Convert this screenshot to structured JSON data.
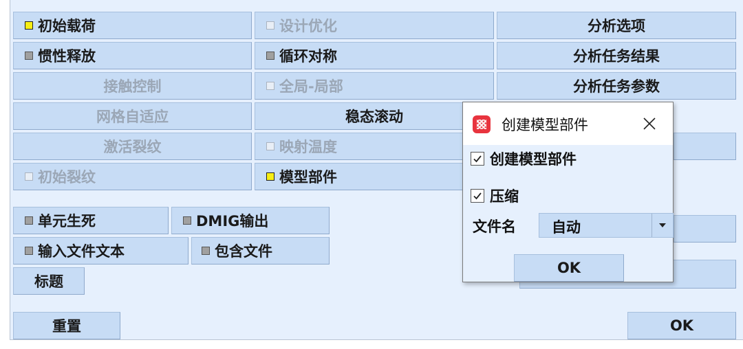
{
  "main_buttons": {
    "initial_load": "初始载荷",
    "design_opt": "设计优化",
    "analysis_options": "分析选项",
    "inertia_relief": "惯性释放",
    "cyclic_symmetry": "循环对称",
    "analysis_task_results": "分析任务结果",
    "contact_control": "接触控制",
    "global_local": "全局-局部",
    "analysis_task_params": "分析任务参数",
    "mesh_adaptive": "网格自适应",
    "steady_rolling": "稳态滚动",
    "activate_crack": "激活裂纹",
    "map_temperature": "映射温度",
    "initial_crack": "初始裂纹",
    "model_part": "模型部件",
    "element_birth_death": "单元生死",
    "dmig_output": "DMIG输出",
    "input_file_text": "输入文件文本",
    "include_file": "包含文件",
    "title": "标题",
    "reset": "重置",
    "ok": "OK"
  },
  "dialog": {
    "title": "创建模型部件",
    "create_model_part_label": "创建模型部件",
    "create_model_part_checked": true,
    "compress_label": "压缩",
    "compress_checked": true,
    "filename_label": "文件名",
    "filename_value": "自动",
    "ok": "OK"
  },
  "colors": {
    "panel_bg": "#e6f0fd",
    "button_bg": "#c7dcf5",
    "indicator_active": "#f7ee14",
    "disabled_text": "#9ba7b6",
    "app_icon": "#e8343e"
  }
}
